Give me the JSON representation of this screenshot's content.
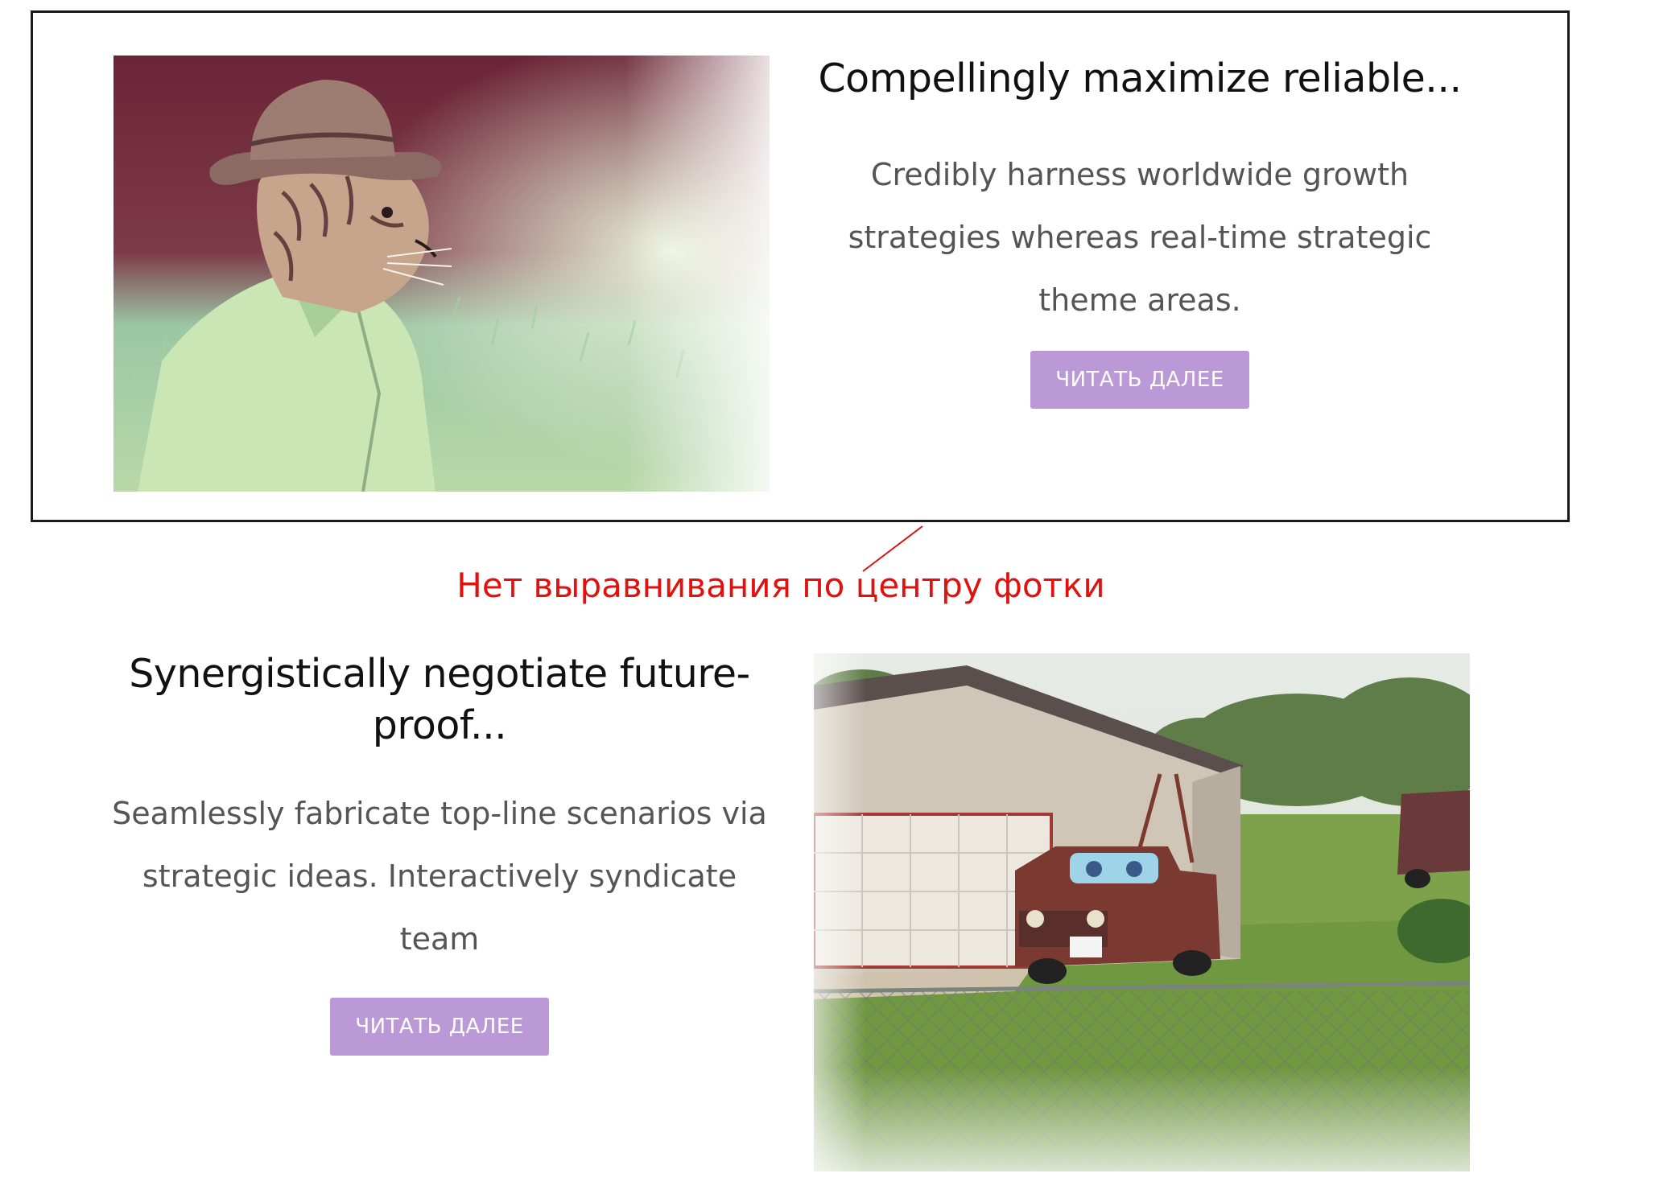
{
  "cards": [
    {
      "title": "Compellingly maximize reliable...",
      "body": "Credibly harness worldwide growth strategies whereas real-time strategic theme areas.",
      "button_label": "ЧИТАТЬ ДАЛЕЕ",
      "image_icon": "tiger-in-hat-photo"
    },
    {
      "title": "Synergistically negotiate future-proof...",
      "body": "Seamlessly fabricate top-line scenarios via strategic ideas. Interactively syndicate team",
      "button_label": "ЧИТАТЬ ДАЛЕЕ",
      "image_icon": "old-truck-with-eyes-photo"
    }
  ],
  "annotation": {
    "note": "Нет выравнивания по центру фотки"
  },
  "colors": {
    "button": "#bb98d6",
    "annotation": "#e0110f",
    "frame": "#1a1a1a"
  }
}
